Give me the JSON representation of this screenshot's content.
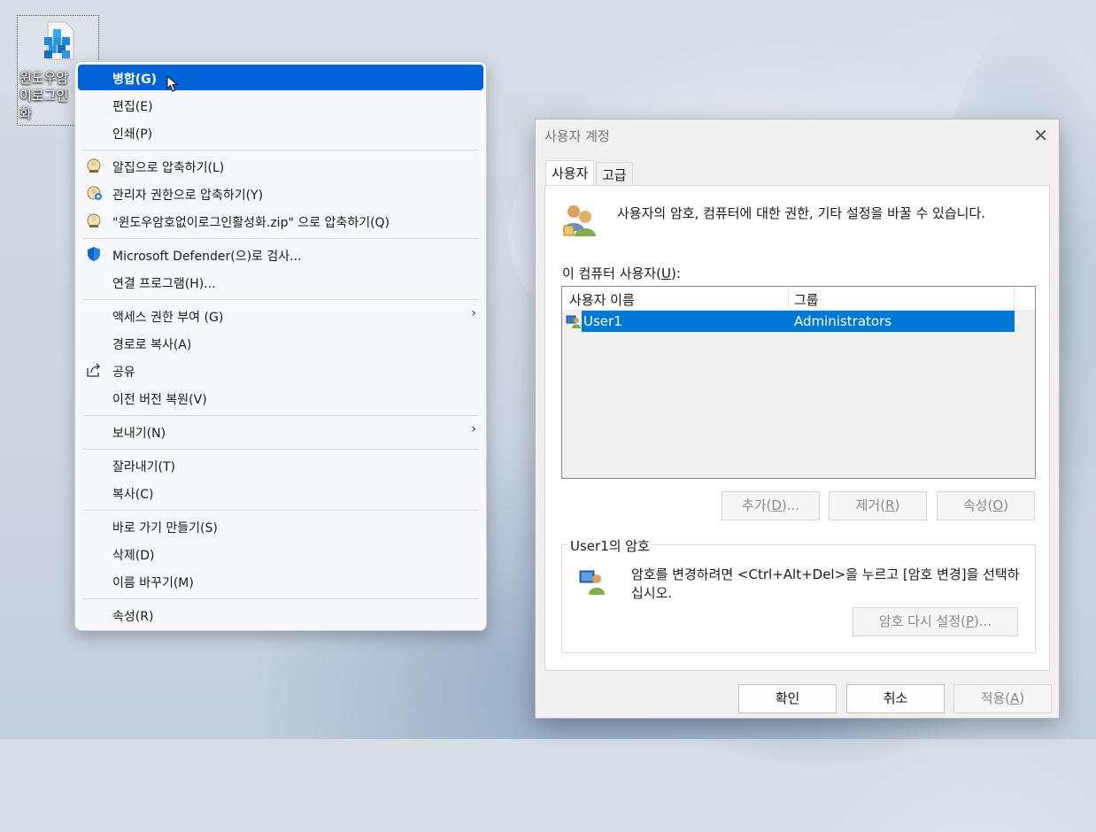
{
  "desktop_icon": {
    "label": "윈도우암호없이로그인활성화",
    "label_visible": "윈도우암\n이로그인\n화"
  },
  "context_menu": {
    "items": [
      {
        "label": "병합(G)",
        "icon": "",
        "highlighted": true
      },
      {
        "label": "편집(E)",
        "icon": ""
      },
      {
        "label": "인쇄(P)",
        "icon": ""
      },
      {
        "label": "알집으로 압축하기(L)",
        "icon": "alzip-icon"
      },
      {
        "label": "관리자 권한으로 압축하기(Y)",
        "icon": "alzip-admin-icon"
      },
      {
        "label": "\"윈도우암호없이로그인활성화.zip\" 으로 압축하기(Q)",
        "icon": "alzip-icon"
      },
      {
        "label": "Microsoft Defender(으)로 검사...",
        "icon": "defender-shield-icon"
      },
      {
        "label": "연결 프로그램(H)...",
        "icon": ""
      },
      {
        "label": "액세스 권한 부여 (G)",
        "icon": "",
        "submenu": true
      },
      {
        "label": "경로로 복사(A)",
        "icon": ""
      },
      {
        "label": "공유",
        "icon": "share-icon"
      },
      {
        "label": "이전 버전 복원(V)",
        "icon": ""
      },
      {
        "label": "보내기(N)",
        "icon": "",
        "submenu": true
      },
      {
        "label": "잘라내기(T)",
        "icon": ""
      },
      {
        "label": "복사(C)",
        "icon": ""
      },
      {
        "label": "바로 가기 만들기(S)",
        "icon": ""
      },
      {
        "label": "삭제(D)",
        "icon": ""
      },
      {
        "label": "이름 바꾸기(M)",
        "icon": ""
      },
      {
        "label": "속성(R)",
        "icon": ""
      }
    ],
    "submenu_arrow": "›"
  },
  "dialog": {
    "title": "사용자 계정",
    "close_glyph": "✕",
    "tabs": [
      {
        "label": "사용자"
      },
      {
        "label": "고급"
      }
    ],
    "description": "사용자의 암호, 컴퓨터에 대한 권한, 기타 설정을 바꿀 수 있습니다.",
    "users_label": "이 컴퓨터 사용자(",
    "users_label_key": "U",
    "users_label_end": "):",
    "columns": [
      "사용자 이름",
      "그룹"
    ],
    "rows": [
      {
        "name": "User1",
        "group": "Administrators"
      }
    ],
    "buttons": {
      "add": {
        "pre": "추가(",
        "key": "D",
        "post": ")..."
      },
      "remove": {
        "pre": "제거(",
        "key": "R",
        "post": ")"
      },
      "properties": {
        "pre": "속성(",
        "key": "O",
        "post": ")"
      }
    },
    "password_group": {
      "legend": "User1의 암호",
      "message": "암호를 변경하려면 <Ctrl+Alt+Del>을 누르고 [암호 변경]을 선택하십시오.",
      "reset_button": {
        "pre": "암호 다시 설정(",
        "key": "P",
        "post": ")..."
      }
    },
    "footer": {
      "ok": "확인",
      "cancel": "취소",
      "apply": {
        "pre": "적용(",
        "key": "A",
        "post": ")"
      }
    }
  },
  "colors": {
    "highlight": "#0063d8",
    "selection": "#0078d7"
  }
}
